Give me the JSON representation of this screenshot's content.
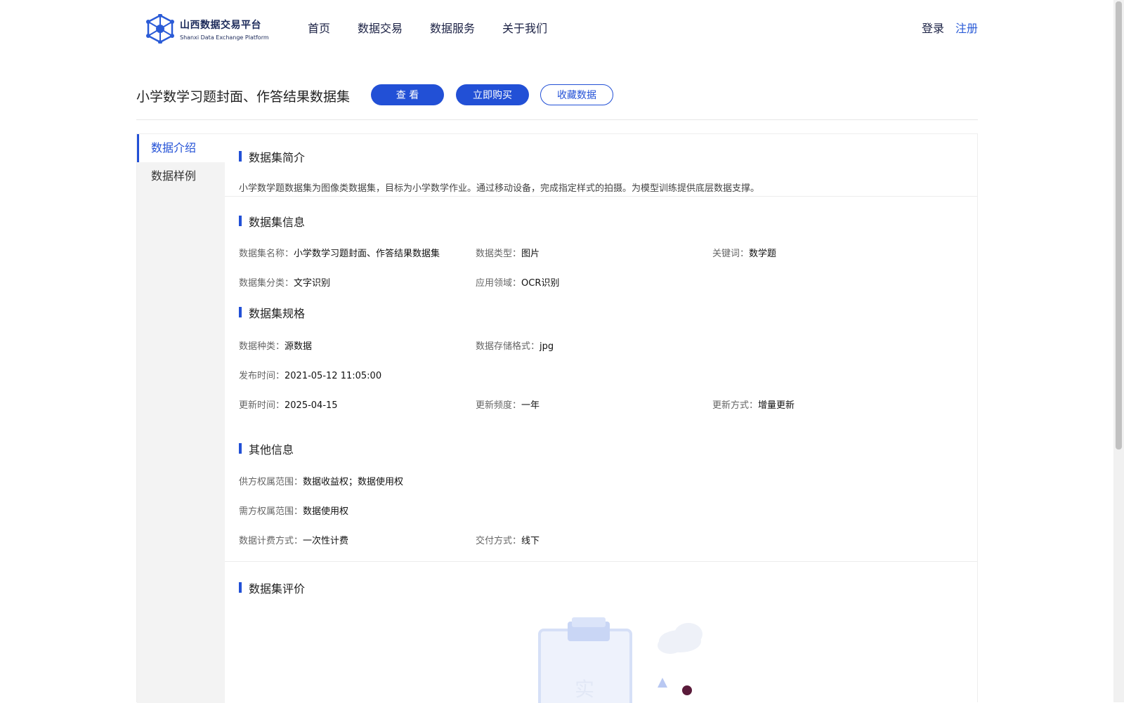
{
  "header": {
    "logo_cn": "山西数据交易平台",
    "logo_en": "Shanxi Data Exchange Platform",
    "nav": [
      "首页",
      "数据交易",
      "数据服务",
      "关于我们"
    ],
    "login": "登录",
    "register": "注册"
  },
  "dataset": {
    "title": "小学数学习题封面、作答结果数据集",
    "btn_view": "查 看",
    "btn_buy": "立即购买",
    "btn_fav": "收藏数据"
  },
  "sidebar": {
    "items": [
      "数据介绍",
      "数据样例"
    ]
  },
  "intro": {
    "title": "数据集简介",
    "text": "小学数学题数据集为图像类数据集，目标为小学数学作业。通过移动设备，完成指定样式的拍摄。为模型训练提供底层数据支撑。"
  },
  "info": {
    "title": "数据集信息",
    "name_k": "数据集名称：",
    "name_v": "小学数学习题封面、作答结果数据集",
    "type_k": "数据类型：",
    "type_v": "图片",
    "keyword_k": "关键词：",
    "keyword_v": "数学题",
    "category_k": "数据集分类：",
    "category_v": "文字识别",
    "domain_k": "应用领域：",
    "domain_v": "OCR识别"
  },
  "spec": {
    "title": "数据集规格",
    "kind_k": "数据种类：",
    "kind_v": "源数据",
    "format_k": "数据存储格式：",
    "format_v": "jpg",
    "publish_k": "发布时间：",
    "publish_v": "2021-05-12 11:05:00",
    "update_k": "更新时间：",
    "update_v": "2025-04-15",
    "freq_k": "更新频度：",
    "freq_v": "一年",
    "mode_k": "更新方式：",
    "mode_v": "增量更新"
  },
  "other": {
    "title": "其他信息",
    "supply_k": "供方权属范围：",
    "supply_v": "数据收益权；数据使用权",
    "demand_k": "需方权属范围：",
    "demand_v": "数据使用权",
    "billing_k": "数据计费方式：",
    "billing_v": "一次性计费",
    "delivery_k": "交付方式：",
    "delivery_v": "线下"
  },
  "review": {
    "title": "数据集评价"
  },
  "colors": {
    "accent": "#2250d6",
    "sidebar_bg": "#f3f3f3"
  }
}
